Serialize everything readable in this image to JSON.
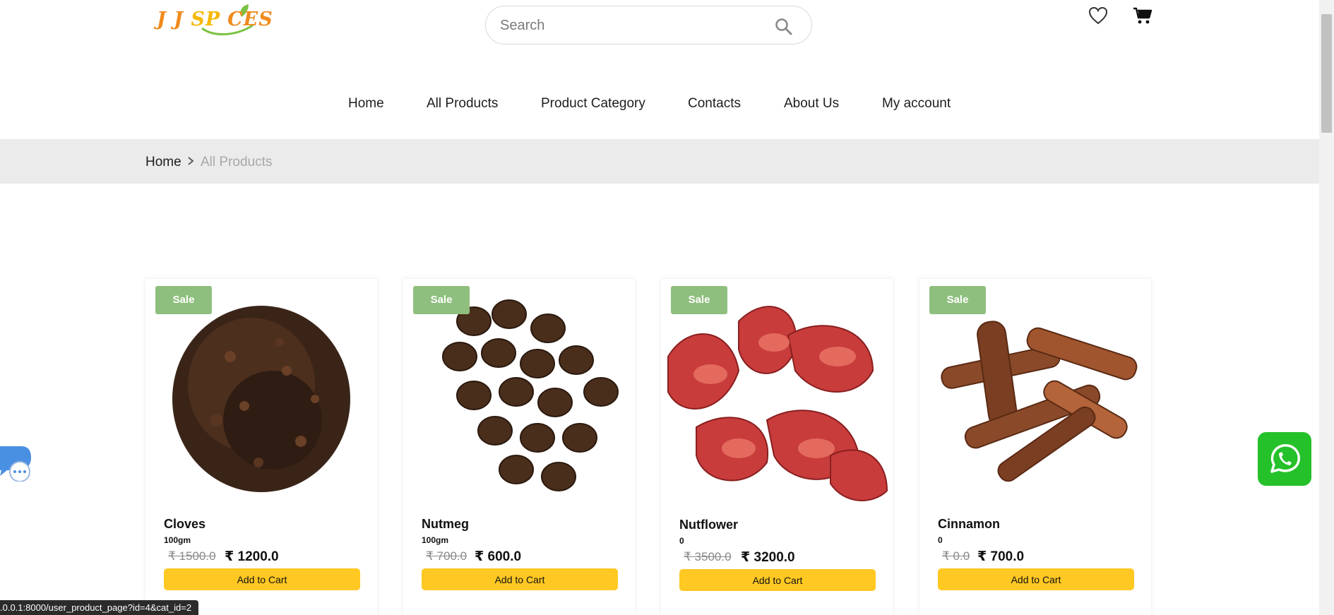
{
  "brand": {
    "logo_text_a": "J J ",
    "logo_text_b": "SP",
    "logo_text_c": "CES",
    "colors": {
      "orange": "#f08a1c",
      "yellow": "#f5b800",
      "green": "#7cc242"
    }
  },
  "search": {
    "placeholder": "Search",
    "icon": "search-icon"
  },
  "header_icons": {
    "wishlist": "heart-icon",
    "cart": "cart-icon"
  },
  "nav": {
    "items": [
      {
        "label": "Home"
      },
      {
        "label": "All Products"
      },
      {
        "label": "Product Category"
      },
      {
        "label": "Contacts"
      },
      {
        "label": "About Us"
      },
      {
        "label": "My account"
      }
    ]
  },
  "breadcrumb": {
    "home": "Home",
    "current": "All Products"
  },
  "products": [
    {
      "badge": "Sale",
      "name": "Cloves",
      "qty": "100gm",
      "old_price": "₹ 1500.0",
      "price": "₹ 1200.0",
      "button": "Add to Cart"
    },
    {
      "badge": "Sale",
      "name": "Nutmeg",
      "qty": "100gm",
      "old_price": "₹ 700.0",
      "price": "₹ 600.0",
      "button": "Add to Cart"
    },
    {
      "badge": "Sale",
      "name": "Nutflower",
      "qty": "0",
      "old_price": "₹ 3500.0",
      "price": "₹ 3200.0",
      "button": "Add to Cart"
    },
    {
      "badge": "Sale",
      "name": "Cinnamon",
      "qty": "0",
      "old_price": "₹ 0.0",
      "price": "₹ 700.0",
      "button": "Add to Cart"
    }
  ],
  "colors": {
    "badge": "#8fbf7e",
    "button": "#ffc823",
    "whatsapp": "#25c12a",
    "breadcrumb_bg": "#ebebeb"
  },
  "status_bar": ".0.0.1:8000/user_product_page?id=4&cat_id=2"
}
